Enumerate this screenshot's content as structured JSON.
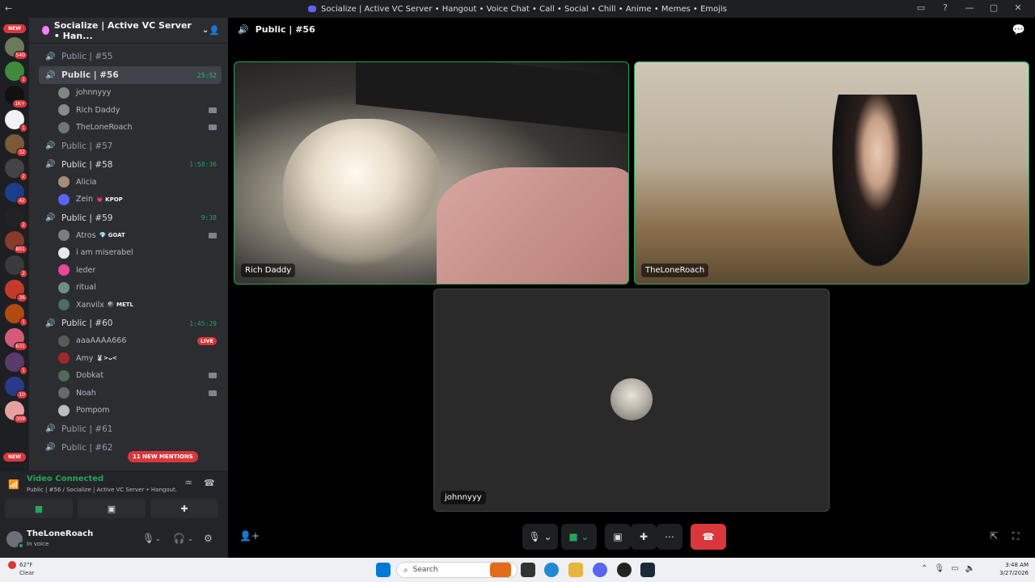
{
  "window": {
    "title": "Socialize | Active VC Server • Hangout • Voice Chat • Call • Social • Chill • Anime • Memes • Emojis"
  },
  "server_rail": {
    "new_badge_top": "NEW",
    "new_badge_bottom": "NEW",
    "counts": [
      "540",
      "1",
      "1K+",
      "1",
      "32",
      "2",
      "42",
      "2",
      "891",
      "2",
      "36",
      "1",
      "631",
      "1",
      "10",
      "309"
    ]
  },
  "server": {
    "name": "Socialize | Active VC Server • Han..."
  },
  "channels": [
    {
      "name": "Public | #55",
      "timer": "",
      "users": []
    },
    {
      "name": "Public | #56",
      "timer": "25:52",
      "active": true,
      "users": [
        {
          "name": "johnnyyy",
          "tag": "",
          "cam": false,
          "color": "#7b8a7f"
        },
        {
          "name": "Rich Daddy",
          "tag": "",
          "cam": true,
          "color": "#8a8a8a"
        },
        {
          "name": "TheLoneRoach",
          "tag": "",
          "cam": true,
          "color": "#6b7a6e"
        }
      ]
    },
    {
      "name": "Public | #57",
      "timer": "",
      "users": []
    },
    {
      "name": "Public | #58",
      "timer": "1:58:36",
      "users": [
        {
          "name": "Alicia",
          "tag": "",
          "cam": false,
          "color": "#a58c7c"
        },
        {
          "name": "Zein",
          "tag": "💗 KPOP",
          "cam": false,
          "color": "#5865f2"
        }
      ]
    },
    {
      "name": "Public | #59",
      "timer": "9:38",
      "users": [
        {
          "name": "Atros",
          "tag": "💎 GOAT",
          "cam": true,
          "color": "#7d7d7d"
        },
        {
          "name": "i am miserabel",
          "tag": "",
          "cam": false,
          "color": "#e9e9e9"
        },
        {
          "name": "leder",
          "tag": "",
          "cam": false,
          "color": "#eb459e"
        },
        {
          "name": "ritual",
          "tag": "",
          "cam": false,
          "color": "#6f8f86"
        },
        {
          "name": "Xanvilx",
          "tag": "🎱 METL",
          "cam": false,
          "color": "#4a6f5a"
        }
      ]
    },
    {
      "name": "Public | #60",
      "timer": "1:45:29",
      "users": [
        {
          "name": "aaaAAAA666",
          "tag": "",
          "cam": false,
          "live": true,
          "color": "#5a5a5a"
        },
        {
          "name": "Amy",
          "tag": "🐰>ᴗ<",
          "cam": false,
          "color": "#a3262a"
        },
        {
          "name": "Dobkat",
          "tag": "",
          "cam": true,
          "color": "#4e6b55"
        },
        {
          "name": "Noah",
          "tag": "",
          "cam": true,
          "color": "#6a6a6a"
        },
        {
          "name": "Pompom",
          "tag": "",
          "cam": false,
          "color": "#bdbdbd"
        }
      ]
    },
    {
      "name": "Public | #61",
      "timer": "",
      "users": []
    },
    {
      "name": "Public | #62",
      "timer": "",
      "users": []
    }
  ],
  "live_label": "LIVE",
  "mentions_badge": "11 NEW MENTIONS",
  "voice_panel": {
    "status": "Video Connected",
    "subtitle": "Public | #56 / Socialize | Active VC Server • Hangout..."
  },
  "user_panel": {
    "name": "TheLoneRoach",
    "status": "In voice"
  },
  "stage": {
    "channel_title": "Public | #56",
    "tiles": [
      {
        "name": "Rich Daddy"
      },
      {
        "name": "TheLoneRoach"
      },
      {
        "name": "johnnyyy"
      }
    ]
  },
  "taskbar": {
    "temp": "62°F",
    "weather": "Clear",
    "search_placeholder": "Search",
    "time": "3:48 AM",
    "date": "3/27/2026"
  },
  "colors": {
    "accent_green": "#23a55a",
    "danger_red": "#da373c",
    "blurple": "#5865f2"
  }
}
